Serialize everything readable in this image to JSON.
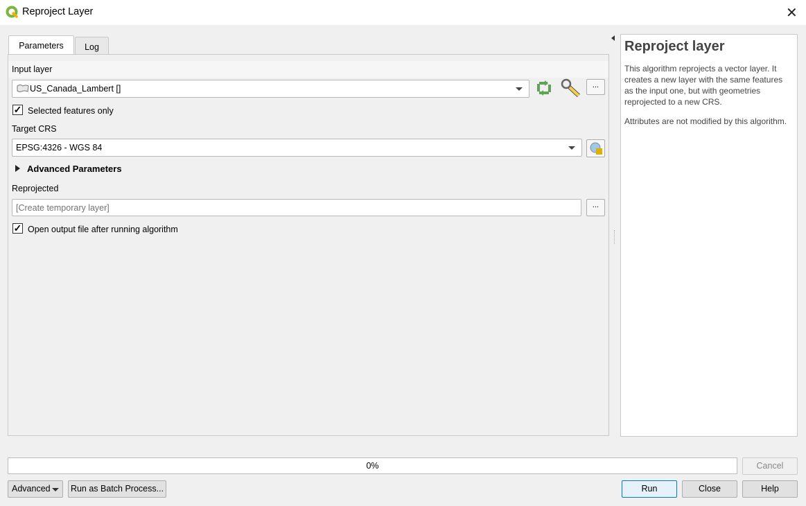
{
  "window": {
    "title": "Reproject Layer"
  },
  "tabs": [
    {
      "label": "Parameters"
    },
    {
      "label": "Log"
    }
  ],
  "params": {
    "input_layer_label": "Input layer",
    "input_layer_value": "US_Canada_Lambert []",
    "selected_only_label": "Selected features only",
    "selected_only_checked": true,
    "target_crs_label": "Target CRS",
    "target_crs_value": "EPSG:4326 - WGS 84",
    "advanced_label": "Advanced Parameters",
    "reprojected_label": "Reprojected",
    "reprojected_placeholder": "[Create temporary layer]",
    "open_output_label": "Open output file after running algorithm",
    "open_output_checked": true,
    "ellipsis": "..."
  },
  "help": {
    "title": "Reproject layer",
    "p1": "This algorithm reprojects a vector layer. It creates a new layer with the same features as the input one, but with geometries reprojected to a new CRS.",
    "p2": "Attributes are not modified by this algorithm."
  },
  "progress": {
    "value": 0,
    "text": "0%"
  },
  "buttons": {
    "cancel": "Cancel",
    "advanced": "Advanced",
    "batch": "Run as Batch Process...",
    "run": "Run",
    "close": "Close",
    "help": "Help"
  }
}
